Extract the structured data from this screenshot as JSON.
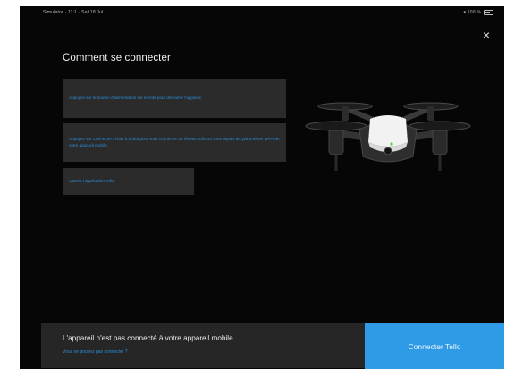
{
  "status_bar": {
    "left_text": "Simulator · 11:1 · Sat 18 Jul",
    "right_text": "▾ 100 %"
  },
  "close_label": "×",
  "page_title": "Comment se connecter",
  "steps": [
    {
      "text": "Appuyez sur le bouton d'alimentation sur le côté pour démarrer l'appareil."
    },
    {
      "text": "Appuyez sur Connecter ci-bas à droite pour vous connecter au réseau Tello ou vous depuis les paramètres Wi-Fi de votre appareil mobile."
    },
    {
      "text": "Ouvrez l'application Tello."
    }
  ],
  "bottom": {
    "message": "L'appareil n'est pas connecté à votre appareil mobile.",
    "help_link": "Vous ne pouvez pas connecter ?",
    "connect_label": "Connecter Tello"
  },
  "colors": {
    "background": "#060606",
    "card": "#2b2b2b",
    "accent_text": "#2b8ed8",
    "primary_button": "#2f9be6"
  }
}
